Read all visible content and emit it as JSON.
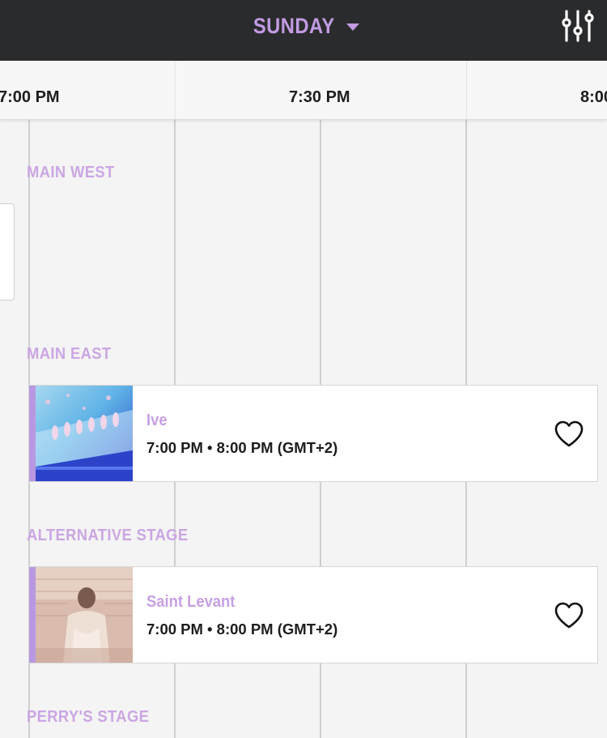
{
  "header": {
    "day_label": "SUNDAY",
    "day_caret_icon": "caret-down-icon",
    "filter_icon": "sliders-filter-icon",
    "accent_color": "#c39be3",
    "background_color": "#2a2b2d"
  },
  "timeline": {
    "times": [
      "7:00 PM",
      "7:30 PM",
      "8:00"
    ]
  },
  "stages": [
    {
      "label": "MAIN WEST"
    },
    {
      "label": "MAIN EAST"
    },
    {
      "label": "ALTERNATIVE STAGE"
    },
    {
      "label": "PERRY'S STAGE"
    }
  ],
  "events": [
    {
      "name": "Ive",
      "time": "7:00 PM • 8:00 PM (GMT+2)",
      "favorite_icon": "heart-outline-icon",
      "thumbnail": "ive-stage-photo"
    },
    {
      "name": "Saint Levant",
      "time": "7:00 PM • 8:00 PM (GMT+2)",
      "favorite_icon": "heart-outline-icon",
      "thumbnail": "saint-levant-photo"
    }
  ]
}
